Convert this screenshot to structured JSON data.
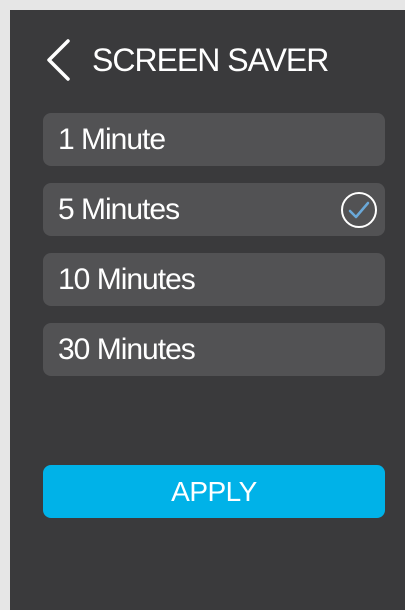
{
  "header": {
    "back_icon": "chevron-left-icon",
    "title": "SCREEN SAVER"
  },
  "options": [
    {
      "label": "1 Minute",
      "selected": false
    },
    {
      "label": "5 Minutes",
      "selected": true
    },
    {
      "label": "10 Minutes",
      "selected": false
    },
    {
      "label": "30 Minutes",
      "selected": false
    }
  ],
  "selected_icon": "check-circle-icon",
  "apply_button": {
    "label": "APPLY"
  },
  "colors": {
    "background": "#3a3a3c",
    "option_background": "#525254",
    "accent": "#00b2e8",
    "text": "#ffffff",
    "check": "#6aa8d8"
  }
}
